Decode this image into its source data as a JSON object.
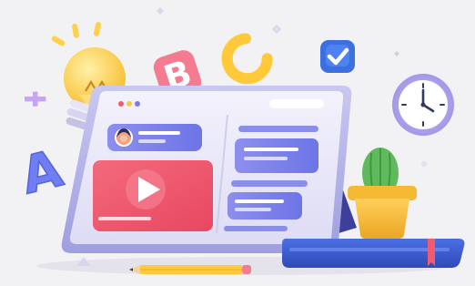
{
  "colors": {
    "background": "#f2f2f5",
    "tablet_frame": "#b7b6e8",
    "tablet_screen": "#e9e7f8",
    "accent_purple": "#7b7be6",
    "video_red": "#f05b6f",
    "bulb_yellow": "#ffd04a",
    "letter_pink": "#f47b90",
    "letter_blue": "#6f7ef2",
    "letter_yellow": "#ffc93a",
    "cactus_green": "#5fba5b",
    "pot_yellow": "#f5b934",
    "book_blue": "#3f5fd6",
    "clock_face": "#ffffff",
    "checkbox_blue": "#3c6fe0"
  },
  "letters": {
    "a": "A",
    "b": "B",
    "c": "C"
  },
  "icons": {
    "bulb": "lightbulb-icon",
    "check": "checkbox-check-icon",
    "clock": "wall-clock-icon",
    "play": "play-icon",
    "avatar": "user-avatar-icon",
    "cactus": "cactus-plant-icon",
    "book": "book-icon",
    "pencil": "pencil-icon"
  }
}
